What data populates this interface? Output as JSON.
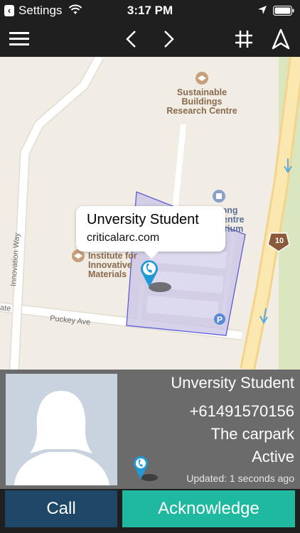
{
  "status_bar": {
    "back_app": "Settings",
    "time": "3:17 PM"
  },
  "nav": {
    "icons": [
      "menu-icon",
      "chevron-left-icon",
      "chevron-right-icon",
      "grid-icon",
      "navigation-arrow-icon"
    ]
  },
  "map": {
    "poi": {
      "sustainable": "Sustainable Buildings Research Centre",
      "institute": "Institute for Innovative Materials",
      "partial": "gong Centre tarium"
    },
    "roads": {
      "innovation_way": "Innovation Way",
      "puckey_ave": "Puckey Ave",
      "edge": "ate"
    },
    "route_shield": "10",
    "callout": {
      "title": "Unversity Student",
      "subtitle": "criticalarc.com"
    }
  },
  "contact": {
    "name": "Unversity Student",
    "phone": "+61491570156",
    "location": "The carpark",
    "status": "Active",
    "updated": "Updated: 1 seconds ago"
  },
  "actions": {
    "call_label": "Call",
    "acknowledge_label": "Acknowledge"
  },
  "colors": {
    "call": "#1f4868",
    "acknowledge": "#1fb9a0",
    "pin": "#1f9ad6",
    "parking_zone": "#5b5bd6"
  }
}
